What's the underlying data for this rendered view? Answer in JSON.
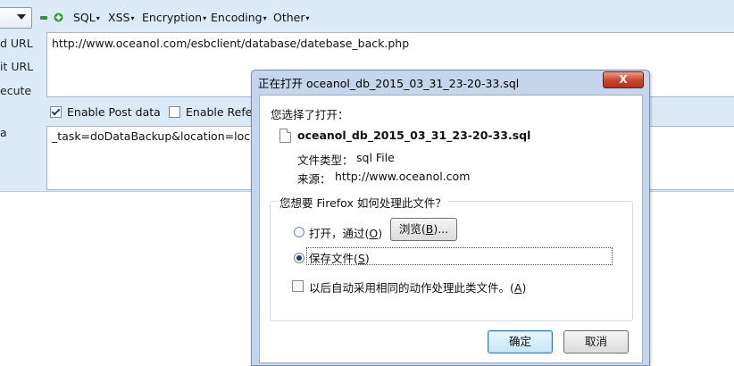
{
  "toolbar": {
    "minus_icon": "minus-icon",
    "plus_icon": "plus-icon",
    "menus": [
      "SQL",
      "XSS",
      "Encryption",
      "Encoding",
      "Other"
    ]
  },
  "labels": {
    "load_url": "d URL",
    "split_url": "it URL",
    "execute": "ecute",
    "post_data": "a"
  },
  "url_value": "http://www.oceanol.com/esbclient/database/datebase_back.php",
  "options": {
    "enable_post": "Enable Post data",
    "enable_referrer": "Enable Refer"
  },
  "post_value": "_task=doDataBackup&location=local",
  "dialog": {
    "title": "正在打开 oceanol_db_2015_03_31_23-20-33.sql",
    "close": "X",
    "chosen_label": "您选择了打开：",
    "filename": "oceanol_db_2015_03_31_23-20-33.sql",
    "type_label": "文件类型：",
    "type_value": "sql File",
    "source_label": "来源：",
    "source_value": "http://www.oceanol.com",
    "question": "您想要 Firefox 如何处理此文件？",
    "open_with": "打开，通过(",
    "open_with_key": "O",
    "browse": "浏览(",
    "browse_key": "B",
    "browse_suffix": ")...",
    "save_file": "保存文件(",
    "save_file_key": "S",
    "auto_action": "以后自动采用相同的动作处理此类文件。(",
    "auto_action_key": "A",
    "close_paren": ")",
    "ok": "确定",
    "cancel": "取消"
  },
  "colors": {
    "hackbar_bg": "#dce9f7",
    "dialog_frame": "#c5d6ec",
    "close_button": "#c6432c"
  }
}
